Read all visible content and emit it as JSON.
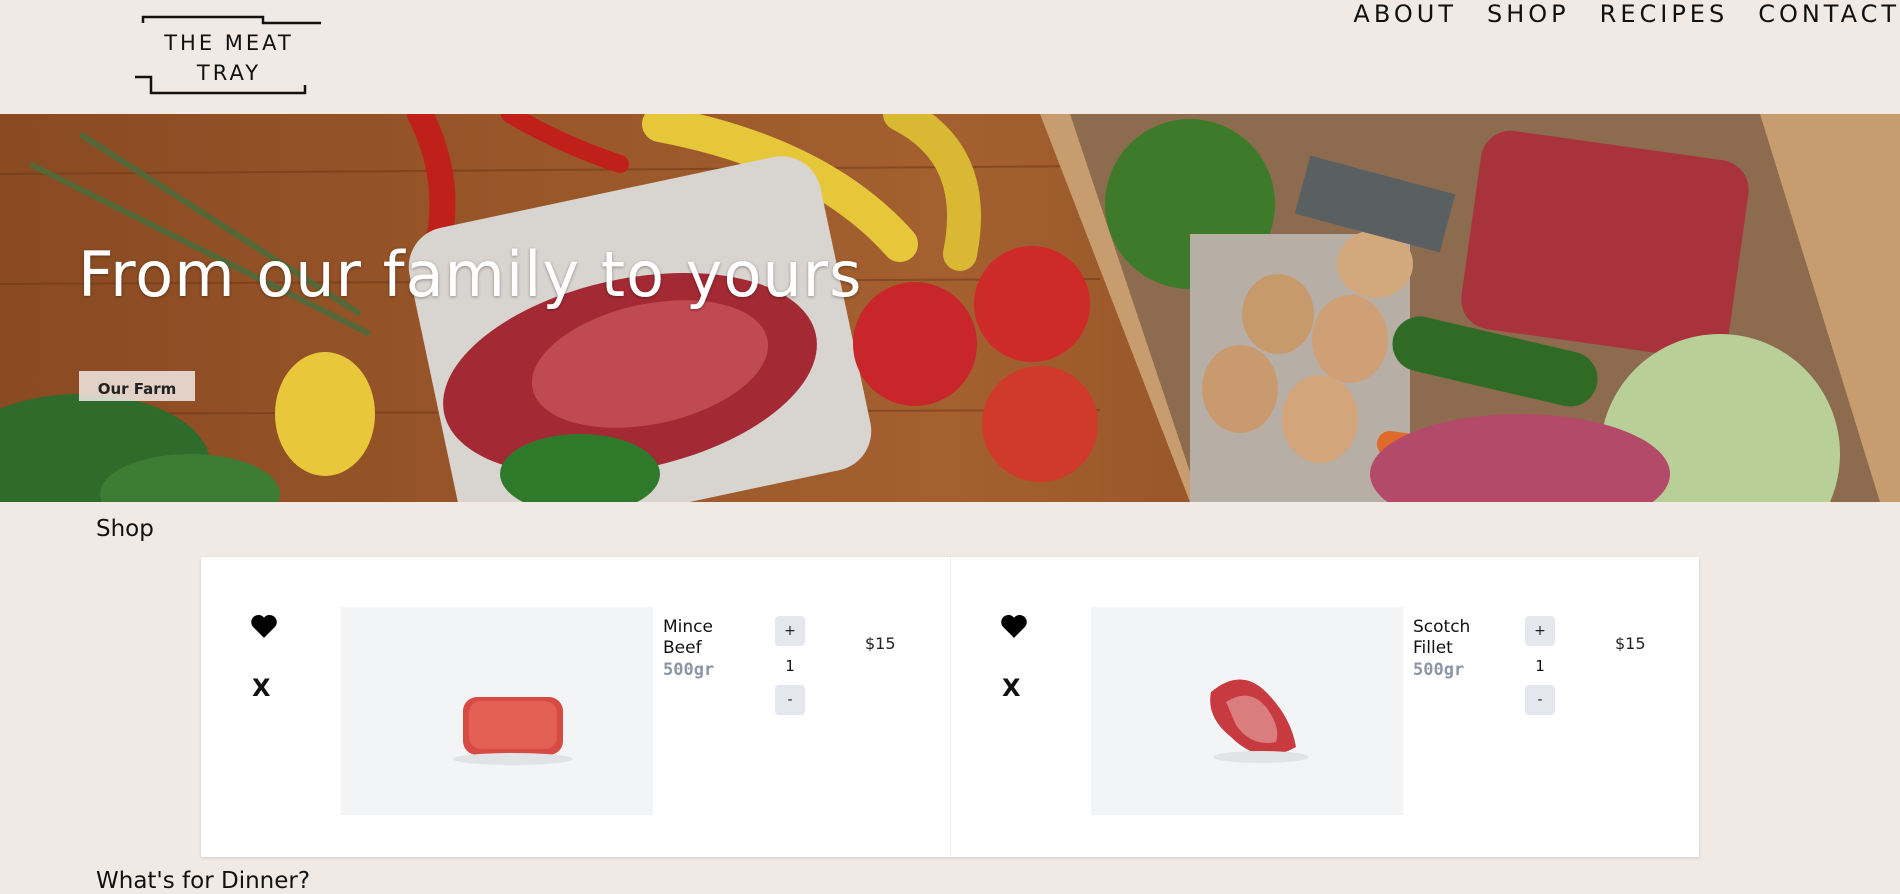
{
  "header": {
    "logo_line1": "THE MEAT",
    "logo_line2": "TRAY",
    "nav": [
      "ABOUT",
      "SHOP",
      "RECIPES",
      "CONTACT"
    ]
  },
  "hero": {
    "title": "From our family to yours",
    "button_label": "Our Farm"
  },
  "shop": {
    "title": "Shop",
    "items": [
      {
        "name": "Mince Beef",
        "weight": "500gr",
        "quantity": "1",
        "price": "$15",
        "plus": "+",
        "minus": "-",
        "remove": "X",
        "icon": "heart-icon"
      },
      {
        "name": "Scotch Fillet",
        "weight": "500gr",
        "quantity": "1",
        "price": "$15",
        "plus": "+",
        "minus": "-",
        "remove": "X",
        "icon": "heart-icon"
      }
    ]
  },
  "dinner": {
    "title": "What's for Dinner?"
  },
  "colors": {
    "background": "#f0e9e4",
    "panel": "#ffffff",
    "weight_text": "#8a96a8",
    "qty_button": "#e4e8ee"
  }
}
